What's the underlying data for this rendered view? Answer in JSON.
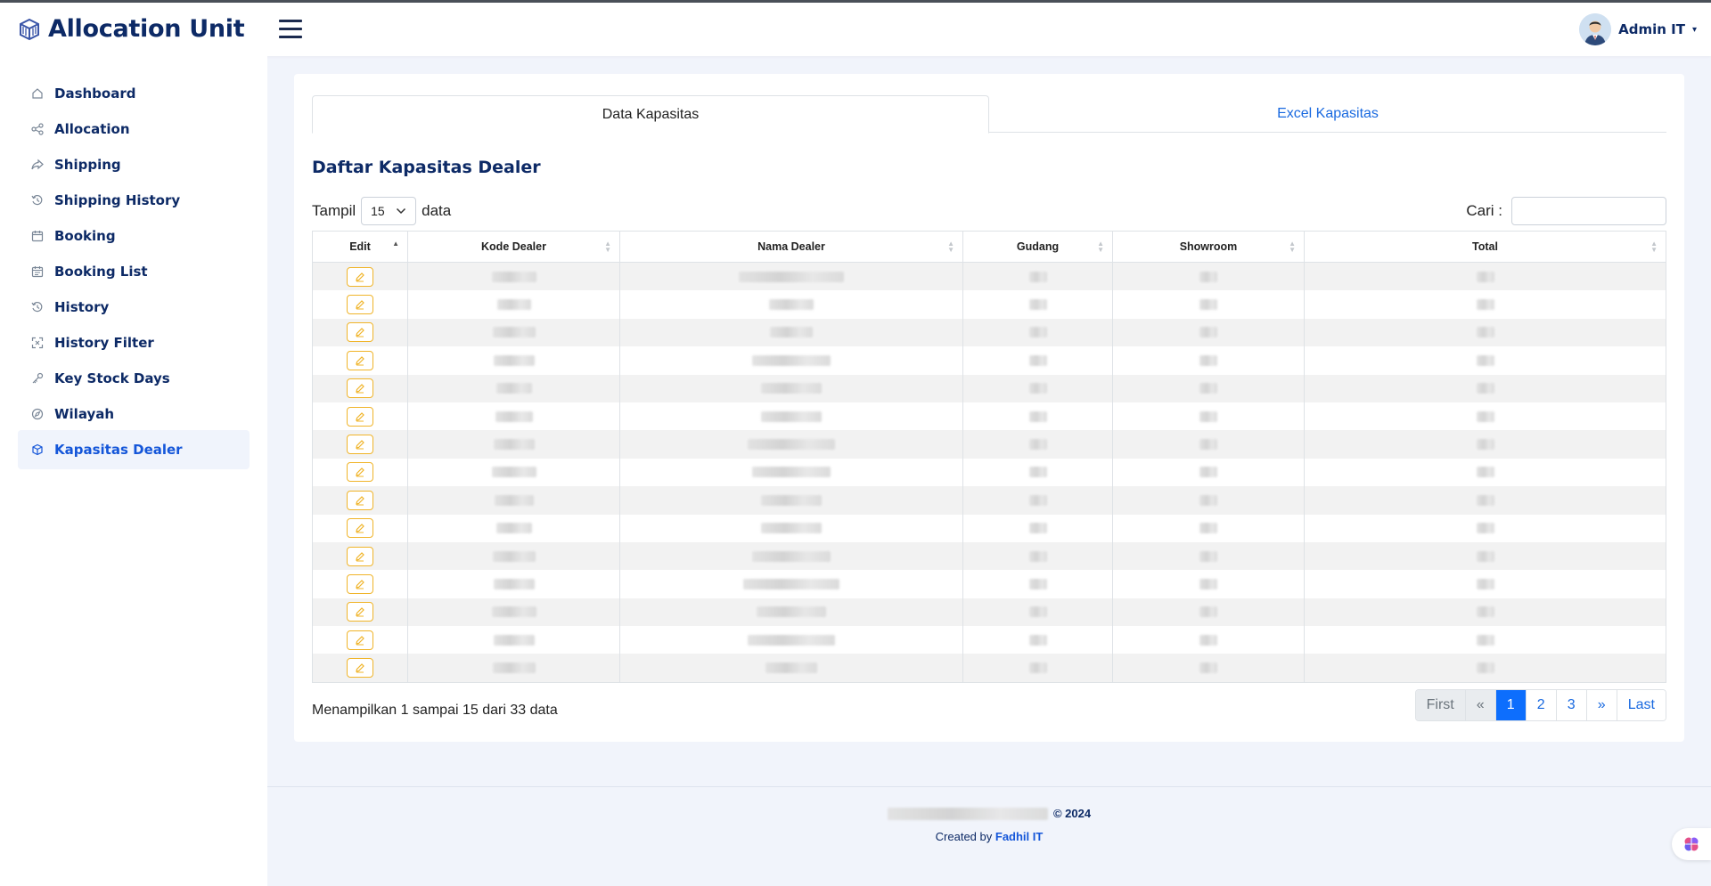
{
  "app": {
    "title": "Allocation Unit"
  },
  "user": {
    "name": "Admin IT"
  },
  "sidebar": {
    "items": [
      {
        "label": "Dashboard",
        "icon": "home-icon"
      },
      {
        "label": "Allocation",
        "icon": "share-icon"
      },
      {
        "label": "Shipping",
        "icon": "forward-icon"
      },
      {
        "label": "Shipping History",
        "icon": "history-icon"
      },
      {
        "label": "Booking",
        "icon": "calendar-icon"
      },
      {
        "label": "Booking List",
        "icon": "calendar-list-icon"
      },
      {
        "label": "History",
        "icon": "history-icon"
      },
      {
        "label": "History Filter",
        "icon": "filter-expand-icon"
      },
      {
        "label": "Key Stock Days",
        "icon": "key-icon"
      },
      {
        "label": "Wilayah",
        "icon": "compass-icon"
      },
      {
        "label": "Kapasitas Dealer",
        "icon": "box-icon",
        "active": true
      }
    ]
  },
  "tabs": [
    {
      "label": "Data Kapasitas",
      "active": true
    },
    {
      "label": "Excel Kapasitas",
      "active": false
    }
  ],
  "main": {
    "title": "Daftar Kapasitas Dealer",
    "length_prefix": "Tampil",
    "length_value": "15",
    "length_suffix": "data",
    "search_label": "Cari :",
    "search_value": ""
  },
  "table": {
    "columns": [
      "Edit",
      "Kode Dealer",
      "Nama Dealer",
      "Gudang",
      "Showroom",
      "Total"
    ],
    "sorted_column": "Edit",
    "row_count": 15
  },
  "footer_info": "Menampilkan 1 sampai 15 dari 33 data",
  "pagination": {
    "first": "First",
    "prev": "«",
    "pages": [
      "1",
      "2",
      "3"
    ],
    "current": "1",
    "next": "»",
    "last": "Last"
  },
  "footer": {
    "copyright": "© 2024",
    "created_prefix": "Created by",
    "author": "Fadhil IT"
  },
  "colors": {
    "brand": "#0d2a66",
    "accent": "#1456d9",
    "edit_button": "#f0b429",
    "page_active": "#0d6efd"
  }
}
